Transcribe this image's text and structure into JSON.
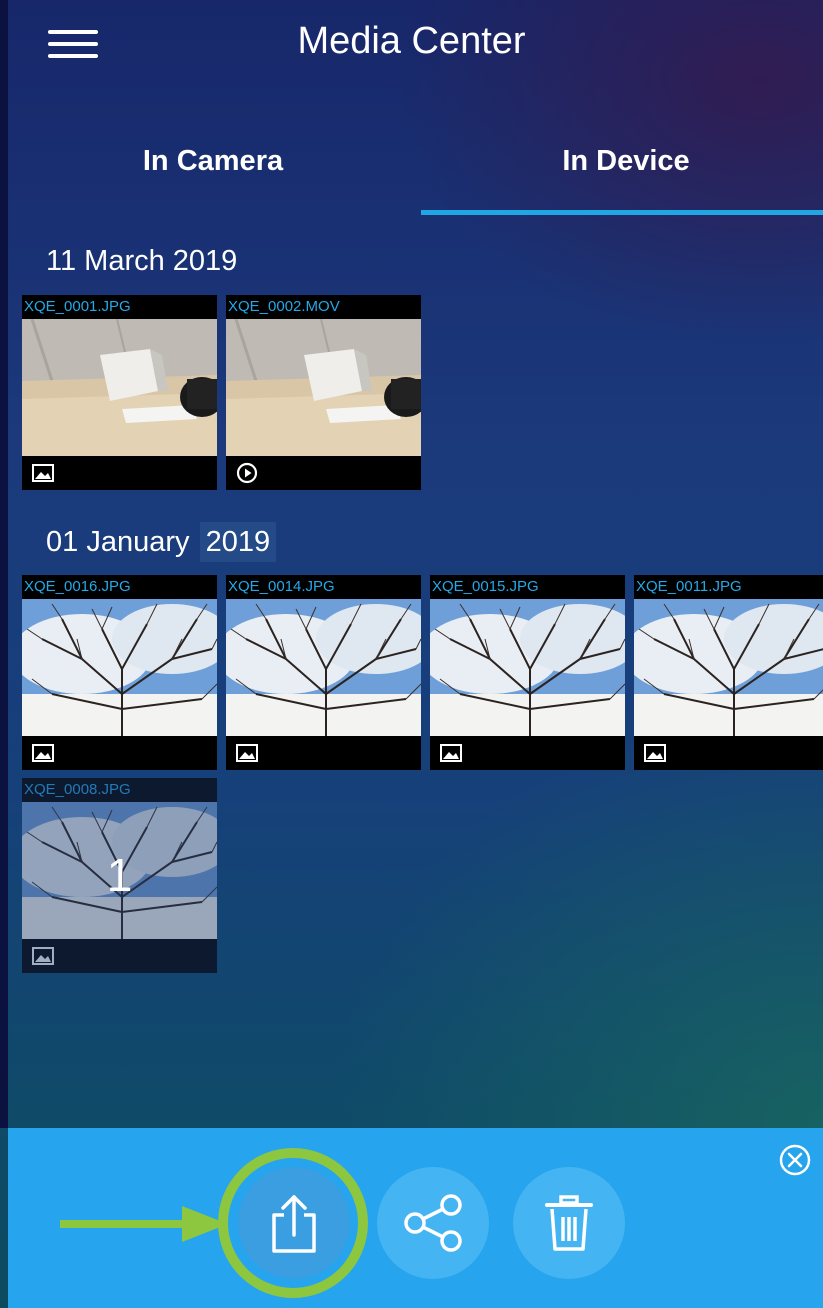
{
  "header": {
    "title": "Media Center",
    "menu_icon": "hamburger-menu-icon"
  },
  "tabs": [
    {
      "label": "In Camera",
      "active": false
    },
    {
      "label": "In Device",
      "active": true
    }
  ],
  "groups": [
    {
      "date_day_month": "11 March 2019",
      "date_year": "",
      "items": [
        {
          "name": "XQE_0001.JPG",
          "type": "image",
          "badge_icon": "image-icon"
        },
        {
          "name": "XQE_0002.MOV",
          "type": "video",
          "badge_icon": "play-icon"
        }
      ]
    },
    {
      "date_day_month": "01 January",
      "date_year": "2019",
      "items": [
        {
          "name": "XQE_0016.JPG",
          "type": "image",
          "badge_icon": "image-icon"
        },
        {
          "name": "XQE_0014.JPG",
          "type": "image",
          "badge_icon": "image-icon"
        },
        {
          "name": "XQE_0015.JPG",
          "type": "image",
          "badge_icon": "image-icon"
        },
        {
          "name": "XQE_0011.JPG",
          "type": "image",
          "badge_icon": "image-icon"
        },
        {
          "name": "XQE_0008.JPG",
          "type": "image",
          "badge_icon": "image-icon",
          "selected": true,
          "selection_number": "1"
        }
      ]
    }
  ],
  "action_bar": {
    "buttons": [
      {
        "name": "export",
        "icon": "export-upload-icon",
        "highlighted": true
      },
      {
        "name": "share",
        "icon": "share-icon"
      },
      {
        "name": "delete",
        "icon": "trash-icon"
      }
    ],
    "close_icon": "close-circle-icon",
    "highlight_color": "#8dc63f",
    "bar_color": "#27a4ee"
  },
  "colors": {
    "tab_underline": "#20a6e3",
    "filename_text": "#25a8e8"
  }
}
